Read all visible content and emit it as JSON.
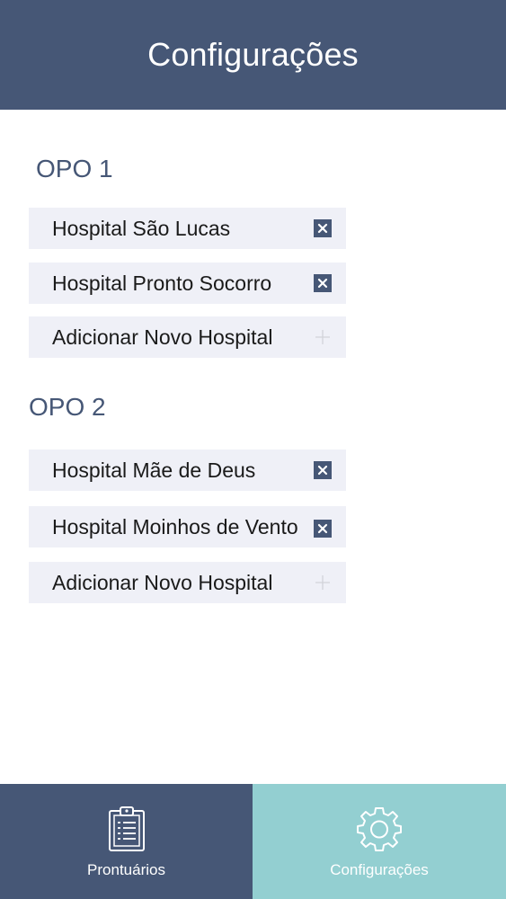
{
  "header": {
    "title": "Configurações"
  },
  "sections": [
    {
      "title": "OPO 1",
      "hospitals": [
        "Hospital São Lucas",
        "Hospital Pronto Socorro"
      ],
      "add_label": "Adicionar Novo Hospital"
    },
    {
      "title": "OPO 2",
      "hospitals": [
        "Hospital Mãe de Deus",
        "Hospital Moinhos de Vento"
      ],
      "add_label": "Adicionar Novo Hospital"
    }
  ],
  "tabs": [
    {
      "label": "Prontuários",
      "icon": "clipboard-icon",
      "active": false
    },
    {
      "label": "Configurações",
      "icon": "gear-icon",
      "active": true
    }
  ],
  "colors": {
    "primary": "#465776",
    "accent": "#93cfd1",
    "row_bg": "#eff0f7"
  }
}
